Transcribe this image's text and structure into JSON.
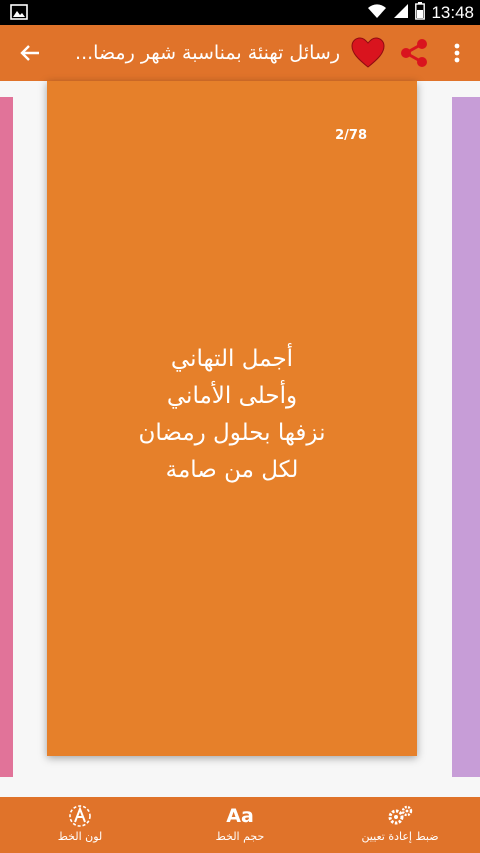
{
  "status_bar": {
    "time": "13:48",
    "icons": [
      "image-icon",
      "wifi-icon",
      "signal-icon",
      "battery-icon"
    ]
  },
  "app_bar": {
    "title": "رسائل تهنئة بمناسبة شهر رمضا...",
    "icons": [
      "back-arrow-icon",
      "heart-icon",
      "share-icon",
      "overflow-menu-icon"
    ]
  },
  "card": {
    "counter": "2/78",
    "lines": [
      "أجمل التهاني",
      "وأحلى الأماني",
      "نزفها بحلول رمضان",
      "لكل من صامة"
    ]
  },
  "bottom_bar": {
    "font_color_label": "لون الخط",
    "font_size_label": "حجم الخط",
    "font_size_icon_text": "Aa",
    "reset_label": "ضبط إعادة تعيين"
  },
  "colors": {
    "app_bar": "#e0732a",
    "card": "#e6802a",
    "left_card": "#e17399",
    "right_card": "#c79dd7",
    "heart": "#d9141e"
  }
}
